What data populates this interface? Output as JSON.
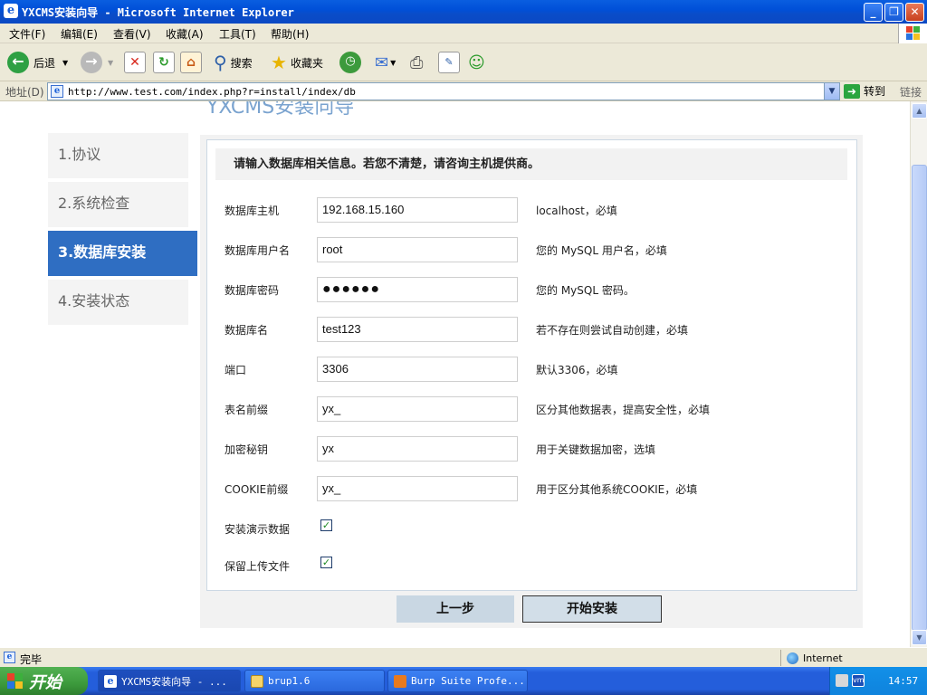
{
  "window": {
    "title": "YXCMS安装向导 - Microsoft Internet Explorer"
  },
  "menu": {
    "items": [
      "文件(F)",
      "编辑(E)",
      "查看(V)",
      "收藏(A)",
      "工具(T)",
      "帮助(H)"
    ]
  },
  "toolbar": {
    "back_label": "后退",
    "search_label": "搜索",
    "favorites_label": "收藏夹"
  },
  "address": {
    "label": "地址(D)",
    "url": "http://www.test.com/index.php?r=install/index/db",
    "go_label": "转到",
    "links_label": "链接"
  },
  "page": {
    "heading": "YXCMS安装向导",
    "steps": [
      "1.协议",
      "2.系统检查",
      "3.数据库安装",
      "4.安装状态"
    ],
    "active_step": 2,
    "notice": "请输入数据库相关信息。若您不清楚，请咨询主机提供商。",
    "fields": [
      {
        "label": "数据库主机",
        "value": "192.168.15.160",
        "hint": "localhost，必填"
      },
      {
        "label": "数据库用户名",
        "value": "root",
        "hint": "您的 MySQL 用户名，必填"
      },
      {
        "label": "数据库密码",
        "value": "●●●●●●",
        "hint": "您的 MySQL 密码。"
      },
      {
        "label": "数据库名",
        "value": "test123",
        "hint": "若不存在则尝试自动创建，必填"
      },
      {
        "label": "端口",
        "value": "3306",
        "hint": "默认3306，必填"
      },
      {
        "label": "表名前缀",
        "value": "yx_",
        "hint": "区分其他数据表，提高安全性，必填"
      },
      {
        "label": "加密秘钥",
        "value": "yx",
        "hint": "用于关键数据加密，选填"
      },
      {
        "label": "COOKIE前缀",
        "value": "yx_",
        "hint": "用于区分其他系统COOKIE，必填"
      }
    ],
    "checkboxes": [
      {
        "label": "安装演示数据",
        "checked": true
      },
      {
        "label": "保留上传文件",
        "checked": true
      }
    ],
    "prev_button": "上一步",
    "start_button": "开始安装"
  },
  "status": {
    "text": "完毕",
    "zone": "Internet"
  },
  "taskbar": {
    "start_label": "开始",
    "tasks": [
      "YXCMS安装向导 - ...",
      "brup1.6",
      "Burp Suite Profe..."
    ],
    "clock": "14:57"
  },
  "colors": {
    "active_step": "#2f6ec2",
    "titlebar": "#0a5ee0"
  }
}
